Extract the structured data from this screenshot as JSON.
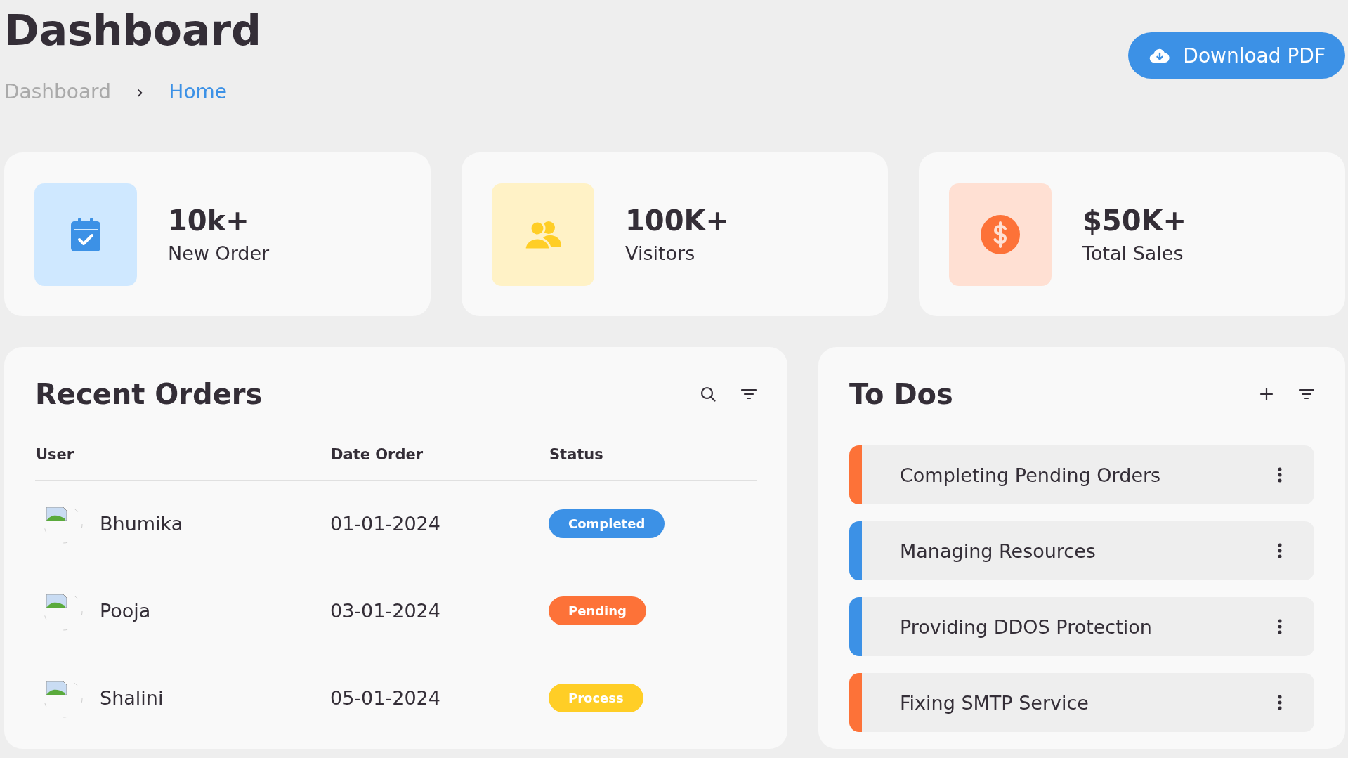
{
  "header": {
    "title": "Dashboard",
    "breadcrumb": [
      {
        "label": "Dashboard",
        "selected": false
      },
      {
        "label": "Home",
        "selected": true
      }
    ],
    "separator": "›",
    "download_button": "Download PDF"
  },
  "stats": [
    {
      "kind": "orders",
      "value": "10k+",
      "label": "New Order"
    },
    {
      "kind": "visitors",
      "value": "100K+",
      "label": "Visitors"
    },
    {
      "kind": "sales",
      "value": "$50K+",
      "label": "Total Sales"
    }
  ],
  "recent_orders": {
    "title": "Recent Orders",
    "columns": [
      "User",
      "Date Order",
      "Status"
    ],
    "rows": [
      {
        "user": "Bhumika",
        "date": "01-01-2024",
        "status": "Completed",
        "kind": "completed"
      },
      {
        "user": "Pooja",
        "date": "03-01-2024",
        "status": "Pending",
        "kind": "pending"
      },
      {
        "user": "Shalini",
        "date": "05-01-2024",
        "status": "Process",
        "kind": "process"
      }
    ]
  },
  "todos": {
    "title": "To Dos",
    "items": [
      {
        "label": "Completing Pending Orders",
        "completed": false
      },
      {
        "label": "Managing Resources",
        "completed": true
      },
      {
        "label": "Providing DDOS Protection",
        "completed": true
      },
      {
        "label": "Fixing SMTP Service",
        "completed": false
      }
    ]
  }
}
